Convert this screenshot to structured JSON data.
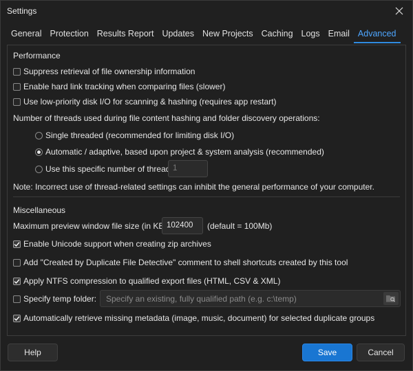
{
  "window": {
    "title": "Settings"
  },
  "tabs": [
    {
      "label": "General"
    },
    {
      "label": "Protection"
    },
    {
      "label": "Results Report"
    },
    {
      "label": "Updates"
    },
    {
      "label": "New Projects"
    },
    {
      "label": "Caching"
    },
    {
      "label": "Logs"
    },
    {
      "label": "Email"
    },
    {
      "label": "Advanced",
      "active": true
    }
  ],
  "performance": {
    "title": "Performance",
    "options": [
      {
        "label": "Suppress retrieval of file ownership information",
        "checked": false
      },
      {
        "label": "Enable hard link tracking when comparing files (slower)",
        "checked": false
      },
      {
        "label": "Use low-priority disk I/O for scanning & hashing (requires app restart)",
        "checked": false
      }
    ],
    "threads_label": "Number of threads used during file content hashing and folder discovery operations:",
    "thread_options": [
      {
        "label": "Single threaded (recommended for limiting disk I/O)",
        "selected": false
      },
      {
        "label": "Automatic / adaptive, based upon project & system analysis (recommended)",
        "selected": true
      },
      {
        "label": "Use this specific number of threads:",
        "selected": false
      }
    ],
    "thread_count": "1",
    "note": "Note: Incorrect use of thread-related settings can inhibit the general performance of your computer."
  },
  "misc": {
    "title": "Miscellaneous",
    "preview_label": "Maximum preview window file size (in KB):",
    "preview_value": "102400",
    "preview_default": "(default = 100Mb)",
    "options": [
      {
        "label": "Enable Unicode support when creating zip archives",
        "checked": true
      },
      {
        "label": "Add \"Created by Duplicate File Detective\" comment to shell shortcuts created by this tool",
        "checked": false
      },
      {
        "label": "Apply NTFS compression to qualified export files (HTML, CSV & XML)",
        "checked": true
      }
    ],
    "temp_folder_label": "Specify temp folder:",
    "temp_folder_checked": false,
    "temp_folder_placeholder": "Specify an existing, fully qualified path (e.g. c:\\temp)",
    "metadata_label": "Automatically retrieve missing metadata (image, music, document) for selected duplicate groups",
    "metadata_checked": true
  },
  "buttons": {
    "help": "Help",
    "save": "Save",
    "cancel": "Cancel"
  },
  "colors": {
    "accent": "#1976d2",
    "tab_active": "#4ea6ff",
    "background": "#202020"
  }
}
